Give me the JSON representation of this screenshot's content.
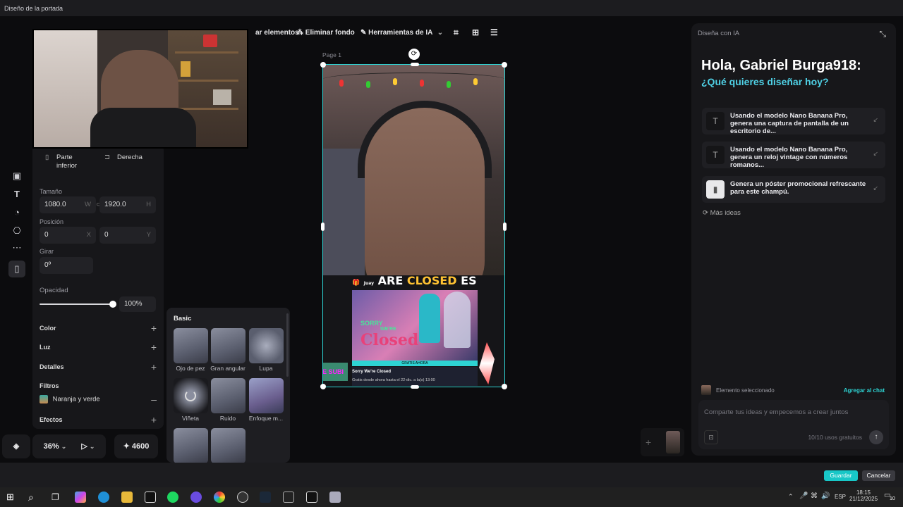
{
  "window": {
    "title": "Diseño de la portada"
  },
  "toolbar": {
    "items": [
      "ar elementos",
      "Eliminar fondo",
      "Herramientas de IA"
    ],
    "icons": [
      "crop-icon",
      "replace-icon",
      "adjust-icon"
    ]
  },
  "canvas": {
    "page_label": "Page 1",
    "overlay_title_1": "ARE",
    "overlay_title_2": "CLOSED",
    "overlay_title_3": "ES",
    "overlay_title_prefix": "Juay",
    "poster_text_1": "SORRY",
    "poster_text_2": "WE'RE",
    "poster_text_3": "Closed",
    "poster_strip": "GRATIS AHORA",
    "card_title": "Sorry We're Closed",
    "card_sub": "Gratis desde ahora hasta el 22-dic. a la(s) 13:00",
    "side_badge": "E SUBI"
  },
  "left_panel": {
    "align_bottom": "Parte inferior",
    "align_right": "Derecha",
    "size_label": "Tamaño",
    "width": "1080.0",
    "width_suffix": "W",
    "height": "1920.0",
    "height_suffix": "H",
    "position_label": "Posición",
    "x": "0",
    "x_suffix": "X",
    "y": "0",
    "y_suffix": "Y",
    "rotate_label": "Girar",
    "rotate": "0º",
    "opacity_label": "Opacidad",
    "opacity": "100%",
    "opacity_value": 1.0,
    "sections": [
      "Color",
      "Luz",
      "Detalles"
    ],
    "filters_label": "Filtros",
    "filter_selected": "Naranja y verde",
    "effects_label": "Efectos"
  },
  "filters": {
    "heading": "Basic",
    "items": [
      "Ojo de pez",
      "Gran angular",
      "Lupa",
      "Viñeta",
      "Ruido",
      "Enfoque m..."
    ]
  },
  "bottom_tools": {
    "zoom": "36%",
    "credits": "4600"
  },
  "right_panel": {
    "header": "Diseña con IA",
    "greeting": "Hola, Gabriel Burga918:",
    "question": "¿Qué quieres diseñar hoy?",
    "suggestions": [
      "Usando el modelo Nano Banana Pro, genera una captura de pantalla de un escritorio de...",
      "Usando el modelo Nano Banana Pro, genera un reloj vintage con números romanos...",
      "Genera un póster promocional refrescante para este champú."
    ],
    "more_ideas": "Más ideas",
    "selected_label": "Elemento seleccionado",
    "add_to_chat": "Agregar al chat",
    "input_placeholder": "Comparte tus ideas y empecemos a crear juntos",
    "usage": "10/10 usos gratuitos"
  },
  "footer": {
    "save": "Guardar",
    "cancel": "Cancelar"
  },
  "taskbar": {
    "lang": "ESP",
    "time": "18:15",
    "date": "21/12/2025",
    "notif": "10"
  },
  "colors": {
    "accent": "#2ed3d3",
    "question": "#4fd1e6",
    "save_btn": "#18c7c7"
  }
}
